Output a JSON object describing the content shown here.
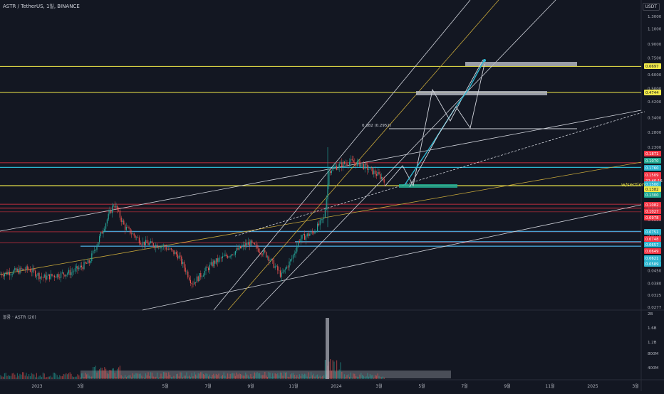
{
  "header": {
    "symbol": "ASTR / TetherUS, 1일, BINANCE",
    "currency": "USDT",
    "volume_title": "볼륨 · ASTR (20)"
  },
  "chart_data": {
    "type": "candlestick",
    "scale": "log",
    "x_ticks": [
      "11월",
      "2023",
      "3월",
      "5월",
      "7월",
      "9월",
      "11월",
      "2024",
      "3월",
      "5월",
      "7월",
      "9월",
      "11월",
      "2025",
      "3월"
    ],
    "y_ticks": [
      "1.3000",
      "1.1000",
      "0.9000",
      "0.7500",
      "0.6000",
      "0.5000",
      "0.4200",
      "0.3400",
      "0.2800",
      "0.2300",
      "0.1900",
      "0.1550",
      "0.1250",
      "0.1050",
      "0.0880",
      "0.0720",
      "0.0590",
      "0.0490",
      "0.0450",
      "0.0380",
      "0.0325",
      "0.0277"
    ],
    "price_labels": [
      {
        "value": "0.6697",
        "color": "#f0e84a",
        "text_color": "#131722"
      },
      {
        "value": "0.4744",
        "color": "#f0e84a",
        "text_color": "#131722"
      },
      {
        "value": "0.1871",
        "color": "#f23645",
        "text_color": "#ffffff"
      },
      {
        "value": "0.1070",
        "color": "#22ab94",
        "text_color": "#ffffff"
      },
      {
        "value": "0.1760",
        "color": "#2db6d0",
        "text_color": "#ffffff"
      },
      {
        "value": "0.1509",
        "color": "#f23645",
        "text_color": "#ffffff"
      },
      {
        "value": "22:40:16",
        "color": "#f23645",
        "text_color": "#ffffff"
      },
      {
        "value": "0.1500",
        "color": "#2db6d0",
        "text_color": "#ffffff"
      },
      {
        "value": "0.1382",
        "color": "#f0e84a",
        "text_color": "#131722"
      },
      {
        "value": "0.1300",
        "color": "#22ab94",
        "text_color": "#ffffff"
      },
      {
        "value": "0.1082",
        "color": "#f23645",
        "text_color": "#ffffff"
      },
      {
        "value": "0.1027",
        "color": "#f23645",
        "text_color": "#ffffff"
      },
      {
        "value": "0.0978",
        "color": "#f23645",
        "text_color": "#ffffff"
      },
      {
        "value": "0.0751",
        "color": "#2db6d0",
        "text_color": "#ffffff"
      },
      {
        "value": "0.0748",
        "color": "#f23645",
        "text_color": "#ffffff"
      },
      {
        "value": "0.0657",
        "color": "#2db6d0",
        "text_color": "#ffffff"
      },
      {
        "value": "0.0649",
        "color": "#f23645",
        "text_color": "#ffffff"
      },
      {
        "value": "0.0621",
        "color": "#2db6d0",
        "text_color": "#ffffff"
      },
      {
        "value": "0.0589",
        "color": "#2db6d0",
        "text_color": "#ffffff"
      }
    ],
    "annotations": [
      {
        "text": "0.382 (0.2952)"
      },
      {
        "text": "w/section"
      }
    ],
    "volume_ticks": [
      "2B",
      "1.6B",
      "1.2B",
      "800M",
      "400M"
    ],
    "colors": {
      "up": "#26a69a",
      "down": "#ef5350",
      "yellow": "#f0e84a",
      "cyan": "#2db6d0"
    }
  }
}
